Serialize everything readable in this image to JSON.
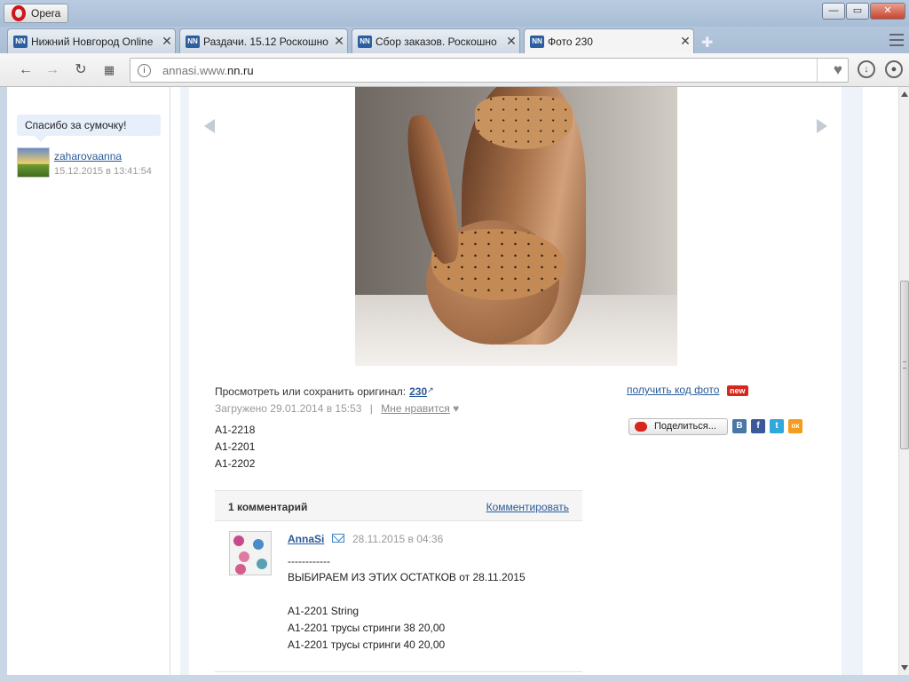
{
  "window": {
    "app_name": "Opera",
    "min_label": "—",
    "max_label": "▭",
    "close_label": "✕"
  },
  "tabs": [
    {
      "favicon": "NN",
      "title": "Нижний Новгород Online",
      "active": false
    },
    {
      "favicon": "NN",
      "title": "Раздачи. 15.12 Роскошно",
      "active": false
    },
    {
      "favicon": "NN",
      "title": "Сбор заказов. Роскошно",
      "active": false
    },
    {
      "favicon": "NN",
      "title": "Фото 230",
      "active": true
    }
  ],
  "tab_close_glyph": "✕",
  "new_tab_glyph": "✚",
  "address": {
    "url_prefix": "annasi.www.",
    "url_domain": "nn.ru",
    "info_glyph": "i"
  },
  "sidebar": {
    "message": "Спасибо за сумочку!",
    "user": "zaharovaanna",
    "date": "15.12.2015 в 13:41:54"
  },
  "photo_info": {
    "original_label": "Просмотреть или сохранить оригинал:",
    "original_link": "230",
    "uploaded": "Загружено 29.01.2014 в 15:53",
    "separator": "|",
    "like_label": "Мне нравится",
    "codes": [
      "A1-2218",
      "A1-2201",
      "A1-2202"
    ]
  },
  "right_panel": {
    "get_code": "получить код фото",
    "new_badge": "new",
    "share_label": "Поделиться...",
    "social": [
      {
        "name": "vk",
        "glyph": "B",
        "color": "#4a76a8"
      },
      {
        "name": "facebook",
        "glyph": "f",
        "color": "#3b5998"
      },
      {
        "name": "twitter",
        "glyph": "t",
        "color": "#2fa8dc"
      },
      {
        "name": "odnoklassniki",
        "glyph": "ок",
        "color": "#f59c1f"
      }
    ]
  },
  "comments": {
    "count_label": "1 комментарий",
    "comment_button": "Комментировать",
    "items": [
      {
        "user": "AnnaSi",
        "date": "28.11.2015 в 04:36",
        "lines": [
          "------------",
          "ВЫБИРАЕМ ИЗ ЭТИХ ОСТАТКОВ от 28.11.2015",
          "",
          "A1-2201 String",
          "A1-2201 трусы стринги 38 20,00",
          "A1-2201 трусы стринги 40 20,00"
        ]
      }
    ]
  }
}
